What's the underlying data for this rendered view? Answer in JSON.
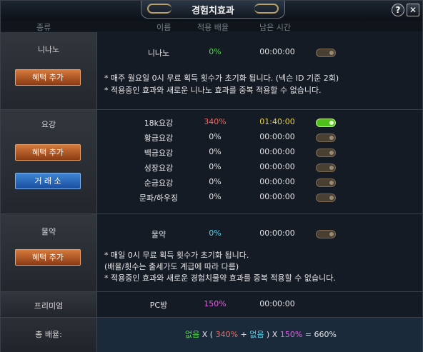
{
  "window": {
    "title": "경험치효과",
    "help_label": "?",
    "close_label": "✕"
  },
  "columns": {
    "category": "종류",
    "name": "이름",
    "rate": "적용 배율",
    "time": "남은 시간"
  },
  "nanano": {
    "label": "니나노",
    "button": "혜택 추가",
    "item": {
      "name": "니나노",
      "rate": "0%",
      "time": "00:00:00",
      "active": false
    },
    "notes": [
      "* 매주 월요일 0시 무료 획득 횟수가 초기화 됩니다. (넥슨 ID 기준 2회)",
      "* 적용중인 효과와 새로운 니나노 효과를 중복 적용할 수 없습니다."
    ]
  },
  "yogang": {
    "label": "요강",
    "button_add": "혜택 추가",
    "button_market": "거 래 소",
    "items": [
      {
        "name": "18k요강",
        "rate": "340%",
        "time": "01:40:00",
        "active": true
      },
      {
        "name": "황금요강",
        "rate": "0%",
        "time": "00:00:00",
        "active": false
      },
      {
        "name": "백금요강",
        "rate": "0%",
        "time": "00:00:00",
        "active": false
      },
      {
        "name": "성장요강",
        "rate": "0%",
        "time": "00:00:00",
        "active": false
      },
      {
        "name": "순금요강",
        "rate": "0%",
        "time": "00:00:00",
        "active": false
      },
      {
        "name": "문파/하우징",
        "rate": "0%",
        "time": "00:00:00",
        "active": false
      }
    ]
  },
  "potion": {
    "label": "물약",
    "button": "혜택 추가",
    "item": {
      "name": "물약",
      "rate": "0%",
      "time": "00:00:00",
      "active": false
    },
    "notes": [
      "* 매일 0시 무료 획득 횟수가 초기화 됩니다.",
      "(배율/횟수는 출세가도 계급에 따라 다름)",
      "* 적용중인 효과와 새로운 경험치물약 효과를 중복 적용할 수 없습니다."
    ]
  },
  "premium": {
    "label": "프리미엄",
    "item": {
      "name": "PC방",
      "rate": "150%",
      "time": "00:00:00"
    }
  },
  "total": {
    "label": "총 배율:",
    "f1": "없음",
    "x1": " X ( ",
    "f2": "340%",
    "plus": " + ",
    "f3": "없음",
    "x2": " ) X ",
    "f4": "150%",
    "eq": " = 660%"
  },
  "colors": {
    "green": "#54d84a",
    "red": "#f06a60",
    "yellow": "#e8d34a",
    "cyan": "#58d2ea",
    "magenta": "#e65fe8"
  }
}
